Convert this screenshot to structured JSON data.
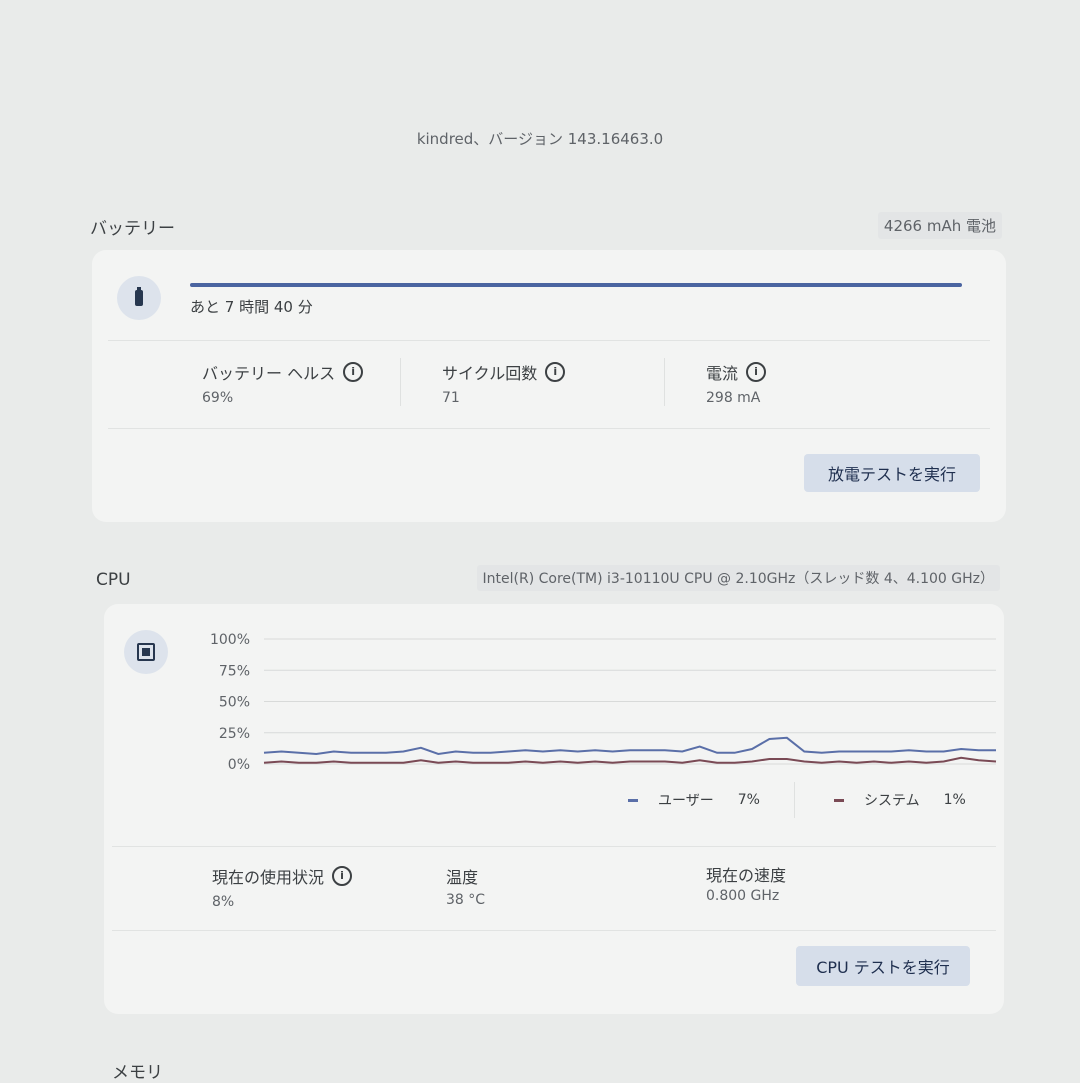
{
  "version_text": "kindred、バージョン 143.16463.0",
  "battery": {
    "title": "バッテリー",
    "capacity": "4266 mAh 電池",
    "time_left": "あと 7 時間 40 分",
    "charge_fraction": 1.0,
    "stats": [
      {
        "label": "バッテリー ヘルス",
        "value": "69%"
      },
      {
        "label": "サイクル回数",
        "value": "71"
      },
      {
        "label": "電流",
        "value": "298 mA"
      }
    ],
    "button": "放電テストを実行",
    "icon": "battery-icon"
  },
  "cpu": {
    "title": "CPU",
    "model": "Intel(R) Core(TM) i3-10110U CPU @ 2.10GHz（スレッド数 4、4.100 GHz）",
    "icon": "cpu-chip-icon",
    "stats": [
      {
        "label": "現在の使用状況",
        "value": "8%"
      },
      {
        "label": "温度",
        "value": "38 °C"
      },
      {
        "label": "現在の速度",
        "value": "0.800 GHz"
      }
    ],
    "button": "CPU テストを実行",
    "legend": [
      {
        "name": "ユーザー",
        "value": "7%",
        "color": "#5a6fa8"
      },
      {
        "name": "システム",
        "value": "1%",
        "color": "#7a4a55"
      }
    ]
  },
  "memory": {
    "title": "メモリ"
  },
  "chart_data": {
    "type": "line",
    "yticks": [
      "100%",
      "75%",
      "50%",
      "25%",
      "0%"
    ],
    "ylim": [
      0,
      100
    ],
    "series": [
      {
        "name": "ユーザー",
        "values": [
          9,
          10,
          9,
          8,
          10,
          9,
          9,
          9,
          10,
          13,
          8,
          10,
          9,
          9,
          10,
          11,
          10,
          11,
          10,
          11,
          10,
          11,
          11,
          11,
          10,
          14,
          9,
          9,
          12,
          20,
          21,
          10,
          9,
          10,
          10,
          10,
          10,
          11,
          10,
          10,
          12,
          11,
          11
        ]
      },
      {
        "name": "システム",
        "values": [
          1,
          2,
          1,
          1,
          2,
          1,
          1,
          1,
          1,
          3,
          1,
          2,
          1,
          1,
          1,
          2,
          1,
          2,
          1,
          2,
          1,
          2,
          2,
          2,
          1,
          3,
          1,
          1,
          2,
          4,
          4,
          2,
          1,
          2,
          1,
          2,
          1,
          2,
          1,
          2,
          5,
          3,
          2
        ]
      }
    ]
  }
}
